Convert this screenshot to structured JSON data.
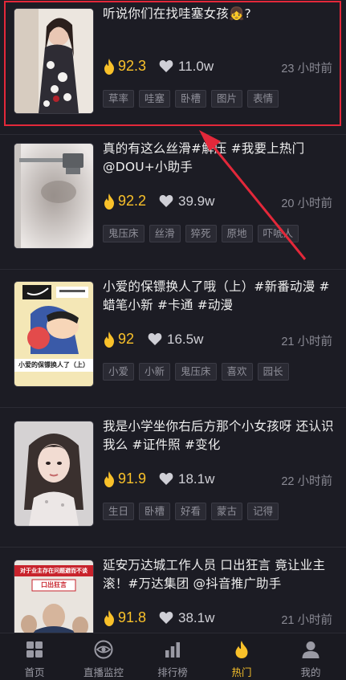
{
  "feed": {
    "items": [
      {
        "title": "听说你们在找哇塞女孩👧?",
        "score": "92.3",
        "likes": "11.0w",
        "time": "23 小时前",
        "tags": [
          "草率",
          "哇塞",
          "卧槽",
          "图片",
          "表情"
        ]
      },
      {
        "title": "真的有这么丝滑#解压 #我要上热门 @DOU+小助手",
        "score": "92.2",
        "likes": "39.9w",
        "time": "20 小时前",
        "tags": [
          "鬼压床",
          "丝滑",
          "猝死",
          "原地",
          "吓唬人"
        ]
      },
      {
        "title": "小爱的保镖换人了哦（上）#新番动漫 #蜡笔小新 #卡通 #动漫",
        "score": "92",
        "likes": "16.5w",
        "time": "21 小时前",
        "tags": [
          "小爱",
          "小新",
          "鬼压床",
          "喜欢",
          "园长"
        ],
        "thumb_caption": "小爱的保镖换人了（上）"
      },
      {
        "title": "我是小学坐你右后方那个小女孩呀 还认识我么 #证件照 #变化",
        "score": "91.9",
        "likes": "18.1w",
        "time": "22 小时前",
        "tags": [
          "生日",
          "卧槽",
          "好看",
          "蒙古",
          "记得"
        ]
      },
      {
        "title": "延安万达城工作人员 口出狂言 竟让业主滚！#万达集团 @抖音推广助手",
        "score": "91.8",
        "likes": "38.1w",
        "time": "21 小时前",
        "tags": [],
        "thumb_caption": "对于业主存在问题避而不谈",
        "thumb_caption2": "口出狂言"
      }
    ]
  },
  "bottom_nav": [
    {
      "label": "首页",
      "icon": "grid-icon"
    },
    {
      "label": "直播监控",
      "icon": "eye-icon"
    },
    {
      "label": "排行榜",
      "icon": "bar-chart-icon"
    },
    {
      "label": "热门",
      "icon": "flame-icon",
      "active": true
    },
    {
      "label": "我的",
      "icon": "user-icon"
    }
  ],
  "colors": {
    "background": "#1c1c24",
    "accent": "#f9c12a",
    "highlight": "#e3283a",
    "muted": "#8a8a94"
  }
}
